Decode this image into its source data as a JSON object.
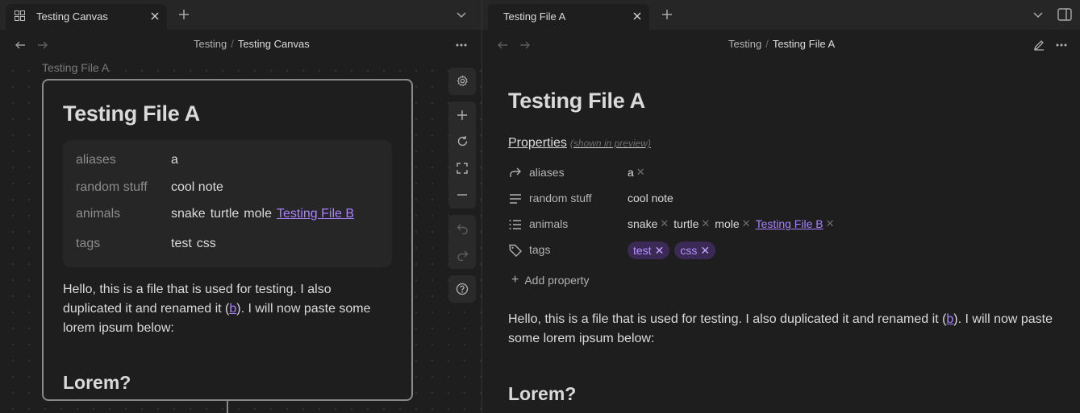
{
  "left_pane": {
    "tab": {
      "label": "Testing Canvas"
    },
    "breadcrumb": {
      "parent": "Testing",
      "current": "Testing Canvas"
    },
    "node": {
      "label": "Testing File A",
      "title": "Testing File A",
      "properties": [
        {
          "key": "aliases",
          "values": [
            "a"
          ]
        },
        {
          "key": "random stuff",
          "values": [
            "cool note"
          ]
        },
        {
          "key": "animals",
          "values": [
            "snake",
            "turtle",
            "mole"
          ],
          "link": "Testing File B"
        },
        {
          "key": "tags",
          "values": [
            "test",
            "css"
          ]
        }
      ],
      "body_before": "Hello, this is a file that is used for testing. I also duplicated it and renamed it (",
      "body_link": "b",
      "body_after": "). I will now paste some lorem ipsum below:",
      "heading": "Lorem?"
    }
  },
  "right_pane": {
    "tab": {
      "label": "Testing File A"
    },
    "breadcrumb": {
      "parent": "Testing",
      "current": "Testing File A"
    },
    "title": "Testing File A",
    "properties_heading": "Properties",
    "properties_note": "(shown in preview)",
    "properties": {
      "aliases": {
        "key": "aliases",
        "values": [
          "a"
        ]
      },
      "random": {
        "key": "random stuff",
        "value": "cool note"
      },
      "animals": {
        "key": "animals",
        "values": [
          "snake",
          "turtle",
          "mole"
        ],
        "link": "Testing File B"
      },
      "tags": {
        "key": "tags",
        "values": [
          "test",
          "css"
        ]
      }
    },
    "add_property": "Add property",
    "body_before": "Hello, this is a file that is used for testing. I also duplicated it and renamed it (",
    "body_link": "b",
    "body_after": "). I will now paste some lorem ipsum below:",
    "heading": "Lorem?"
  },
  "icons": {
    "canvas_tab": "canvas-icon",
    "close": "close-icon",
    "new_tab": "plus-icon",
    "tab_list": "chevron-down-icon",
    "sidebar_toggle": "sidebar-toggle-icon",
    "back": "arrow-left-icon",
    "forward": "arrow-right-icon",
    "more": "more-options-icon",
    "edit": "pencil-icon",
    "settings": "gear-icon",
    "zoom_in": "plus-icon",
    "reset": "refresh-icon",
    "fit": "fullscreen-icon",
    "zoom_out": "minus-icon",
    "undo": "undo-icon",
    "redo": "redo-icon",
    "help": "help-icon"
  },
  "colors": {
    "accent": "#a882ff",
    "tag_bg": "#3b2a55",
    "tag_text": "#b990ff"
  }
}
